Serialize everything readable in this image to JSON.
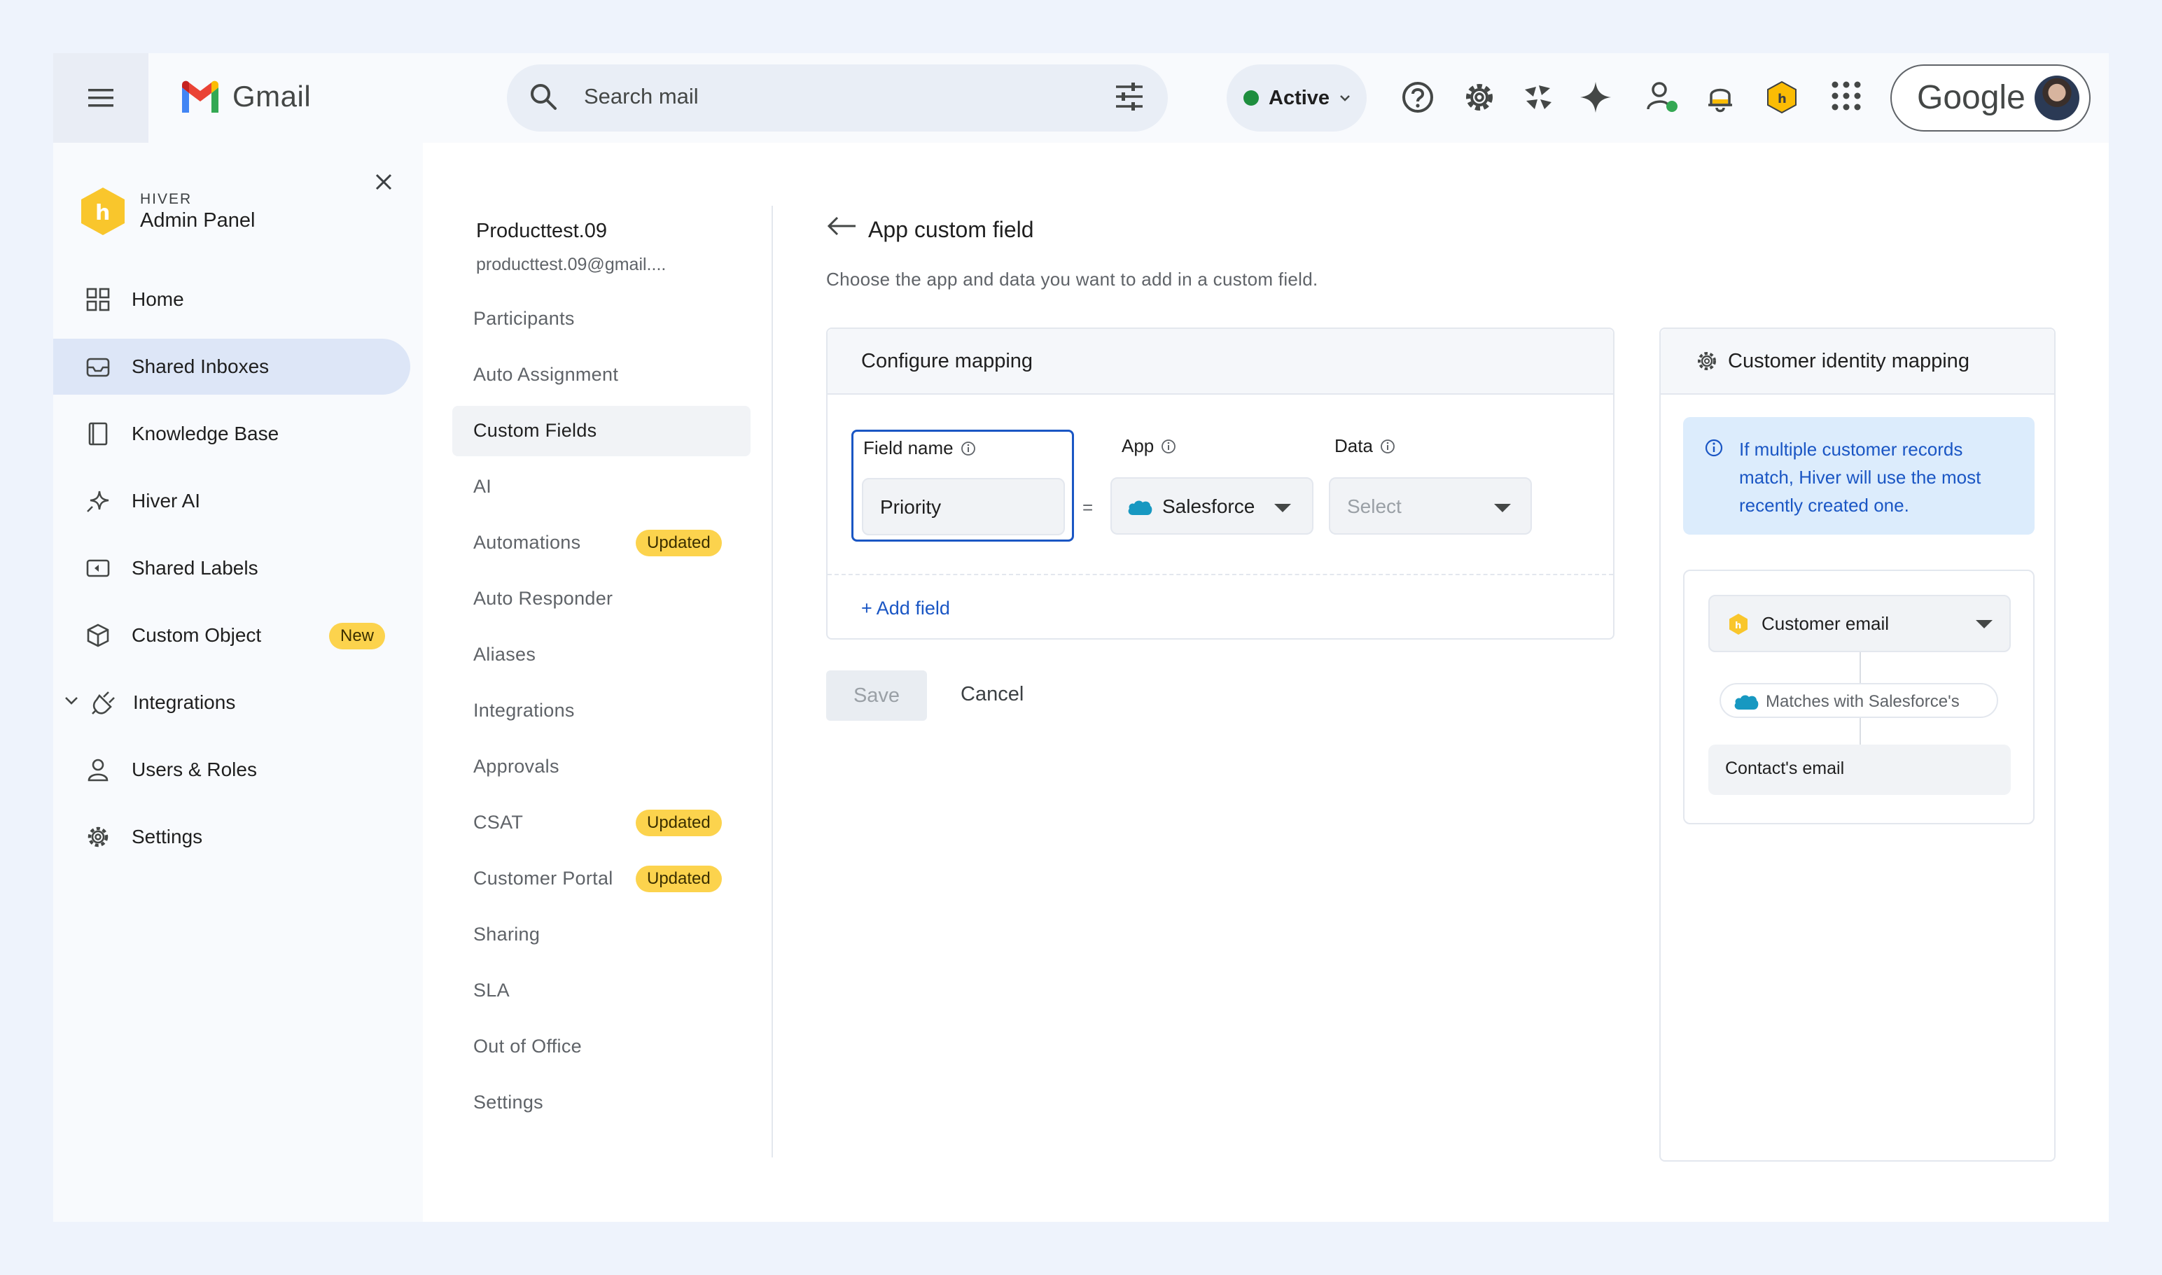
{
  "gmail": {
    "logo_text": "Gmail",
    "search_placeholder": "Search mail",
    "status_label": "Active",
    "google_text": "Google"
  },
  "brand": {
    "small": "HIVER",
    "title": "Admin Panel"
  },
  "sidebar": {
    "items": [
      {
        "label": "Home",
        "icon": "home-grid-icon"
      },
      {
        "label": "Shared Inboxes",
        "icon": "inbox-icon"
      },
      {
        "label": "Knowledge Base",
        "icon": "book-icon"
      },
      {
        "label": "Hiver AI",
        "icon": "sparkle-icon"
      },
      {
        "label": "Shared Labels",
        "icon": "label-icon"
      },
      {
        "label": "Custom Object",
        "icon": "cube-icon",
        "badge": "New"
      },
      {
        "label": "Integrations",
        "icon": "plug-icon"
      },
      {
        "label": "Users & Roles",
        "icon": "user-icon"
      },
      {
        "label": "Settings",
        "icon": "gear-icon"
      }
    ]
  },
  "inbox": {
    "name": "Producttest.09",
    "email": "producttest.09@gmail...."
  },
  "settings_menu": {
    "items": [
      {
        "label": "Participants"
      },
      {
        "label": "Auto Assignment"
      },
      {
        "label": "Custom Fields"
      },
      {
        "label": "AI"
      },
      {
        "label": "Automations",
        "badge": "Updated"
      },
      {
        "label": "Auto Responder"
      },
      {
        "label": "Aliases"
      },
      {
        "label": "Integrations"
      },
      {
        "label": "Approvals"
      },
      {
        "label": "CSAT",
        "badge": "Updated"
      },
      {
        "label": "Customer Portal",
        "badge": "Updated"
      },
      {
        "label": "Sharing"
      },
      {
        "label": "SLA"
      },
      {
        "label": "Out of Office"
      },
      {
        "label": "Settings"
      }
    ]
  },
  "main": {
    "title": "App custom field",
    "subtitle": "Choose the app and data you want to add in a custom field.",
    "card_title": "Configure mapping",
    "field_name_label": "Field name",
    "field_name_value": "Priority",
    "equals": "=",
    "app_label": "App",
    "app_value": "Salesforce",
    "data_label": "Data",
    "data_placeholder": "Select",
    "add_field": "+ Add field",
    "save": "Save",
    "cancel": "Cancel"
  },
  "identity": {
    "title": "Customer identity mapping",
    "info": "If multiple customer records match, Hiver will use the most recently created one.",
    "customer_field": "Customer email",
    "match_text": "Matches with Salesforce's",
    "contact_field": "Contact's email"
  },
  "colors": {
    "accent_blue": "#1a56c4",
    "badge_yellow": "#fcd34d",
    "status_green": "#1e8e3e",
    "selected_nav": "#dde6f7"
  }
}
